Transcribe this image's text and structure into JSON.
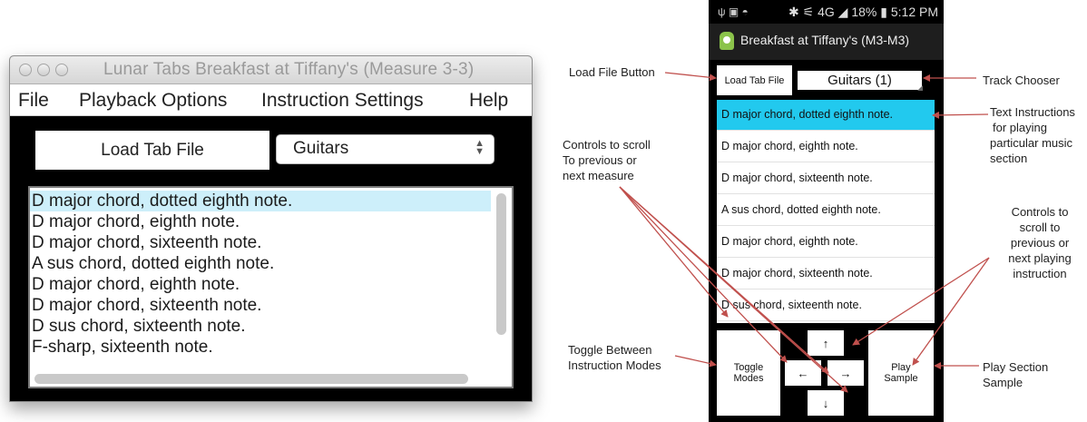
{
  "desktop": {
    "window_title": "Lunar Tabs Breakfast at Tiffany's (Measure 3-3)",
    "menu": [
      "File",
      "Playback Options",
      "Instruction Settings",
      "Help"
    ],
    "load_button": "Load Tab File",
    "track_select": "Guitars",
    "instructions": [
      "D major chord, dotted eighth note.",
      "D major chord, eighth note.",
      "D major chord, sixteenth note.",
      "A sus chord, dotted eighth note.",
      "D major chord, eighth note.",
      "D major chord, sixteenth note.",
      "D sus chord, sixteenth note.",
      "F-sharp, sixteenth note."
    ]
  },
  "phone": {
    "status_time": "5:12 PM",
    "status_battery": "18%",
    "app_title": "Breakfast at Tiffany's (M3-M3)",
    "load_button": "Load Tab File",
    "track_chooser": "Guitars (1)",
    "instructions": [
      "D major chord, dotted eighth note.",
      "D major chord, eighth note.",
      "D major chord, sixteenth note.",
      "A sus chord, dotted eighth note.",
      "D major chord, eighth note.",
      "D major chord, sixteenth note.",
      "D sus chord, sixteenth note."
    ],
    "toggle_button": [
      "Toggle",
      "Modes"
    ],
    "play_button": [
      "Play",
      "Sample"
    ],
    "arrow_up": "↑",
    "arrow_left": "←",
    "arrow_right": "→",
    "arrow_down": "↓"
  },
  "callouts": {
    "load_file": "Load File Button",
    "scroll_measure": [
      "Controls to scroll",
      "To previous or",
      "next measure"
    ],
    "toggle_modes": [
      "Toggle Between",
      "Instruction Modes"
    ],
    "track_chooser": "Track Chooser",
    "text_instructions": [
      "Text Instructions",
      "for playing",
      "particular music",
      "section"
    ],
    "scroll_instruction": [
      "Controls to",
      "scroll to",
      "previous or",
      "next playing",
      "instruction"
    ],
    "play_section": [
      "Play Section",
      "Sample"
    ]
  },
  "colors": {
    "desktop_selection": "#cdeffa",
    "phone_selection": "#22c9ee",
    "arrow_color": "#c0504d"
  }
}
